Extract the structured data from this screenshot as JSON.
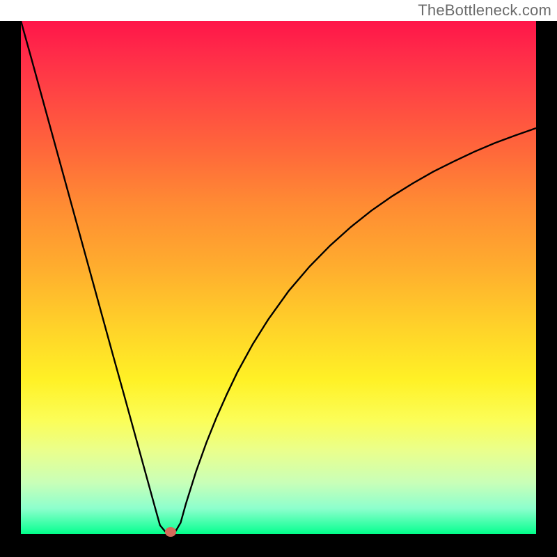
{
  "attribution": "TheBottleneck.com",
  "colors": {
    "frame": "#000000",
    "curve": "#000000",
    "dot": "#d46a5a",
    "gradient_top": "#ff1549",
    "gradient_bottom": "#00ff88"
  },
  "chart_data": {
    "type": "line",
    "title": "",
    "xlabel": "",
    "ylabel": "",
    "xlim": [
      0,
      100
    ],
    "ylim": [
      0,
      100
    ],
    "x": [
      0,
      2,
      4,
      6,
      8,
      10,
      12,
      14,
      16,
      18,
      20,
      22,
      24,
      26,
      27,
      28,
      29,
      30,
      31,
      32,
      33,
      34,
      36,
      38,
      40,
      42,
      45,
      48,
      52,
      56,
      60,
      64,
      68,
      72,
      76,
      80,
      84,
      88,
      92,
      96,
      100
    ],
    "values": [
      100,
      92.8,
      85.5,
      78.2,
      70.9,
      63.6,
      56.3,
      49.0,
      41.7,
      34.4,
      27.2,
      19.9,
      12.6,
      5.3,
      1.7,
      0.5,
      0.5,
      0.5,
      2.2,
      5.8,
      9.0,
      12.2,
      17.8,
      22.8,
      27.3,
      31.5,
      37.0,
      41.8,
      47.4,
      52.1,
      56.2,
      59.8,
      63.0,
      65.8,
      68.3,
      70.6,
      72.6,
      74.5,
      76.2,
      77.7,
      79.1
    ],
    "minimum_marker": {
      "x": 29,
      "y": 0.4
    },
    "annotations": []
  }
}
